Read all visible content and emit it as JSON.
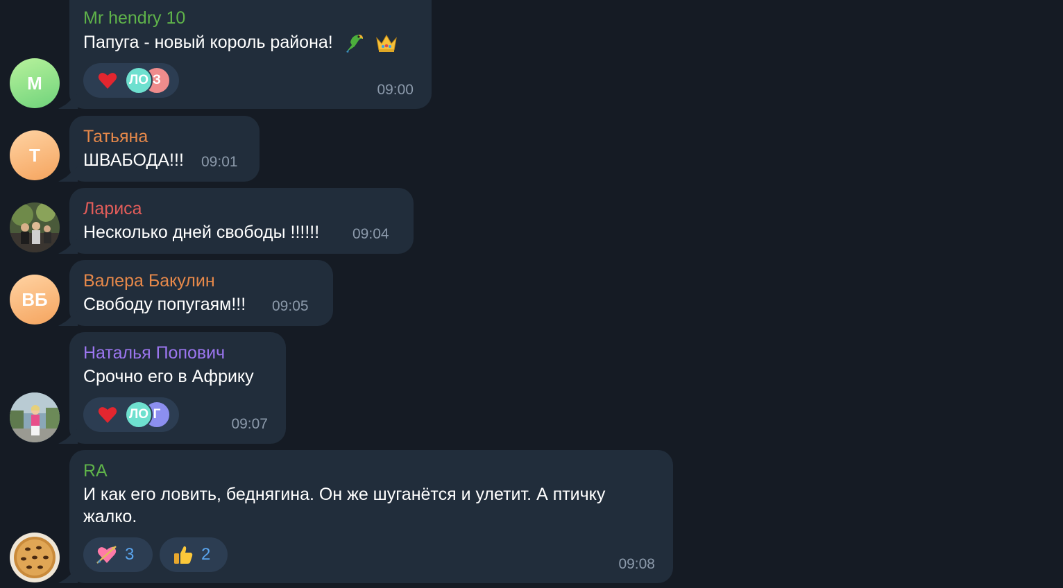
{
  "messages": [
    {
      "sender": "Mr hendry 10",
      "sender_color": "#5fb34a",
      "avatar_initials": "M",
      "text": "Папуга - новый король района!",
      "emoji_icons": [
        "parrot-icon",
        "crown-icon"
      ],
      "reaction_icon": "heart-icon",
      "reactors": [
        "ЛО",
        "З"
      ],
      "time": "09:00"
    },
    {
      "sender": "Татьяна",
      "sender_color": "#e8894a",
      "avatar_initials": "Т",
      "text": "ШВАБОДА!!!",
      "time": "09:01"
    },
    {
      "sender": "Лариса",
      "sender_color": "#e35d5a",
      "avatar_type": "photo",
      "text": "Несколько дней свободы !!!!!!",
      "time": "09:04"
    },
    {
      "sender": "Валера Бакулин",
      "sender_color": "#e8894a",
      "avatar_initials": "ВБ",
      "text": "Свободу попугаям!!!",
      "time": "09:05"
    },
    {
      "sender": "Наталья Попович",
      "sender_color": "#9c76f0",
      "avatar_type": "photo",
      "text": "Срочно его в Африку",
      "reaction_icon": "heart-icon",
      "reactors": [
        "ЛО",
        "Г"
      ],
      "time": "09:07"
    },
    {
      "sender": "RA",
      "sender_color": "#5fb34a",
      "avatar_type": "photo",
      "text_line1": "И как его ловить, беднягина. Он же шуганётся и улетит. А птичку",
      "text_line2": "жалко.",
      "reactions": [
        {
          "icon": "heart-arrow-icon",
          "count": "3"
        },
        {
          "icon": "thumbs-up-icon",
          "count": "2"
        }
      ],
      "time": "09:08"
    }
  ]
}
